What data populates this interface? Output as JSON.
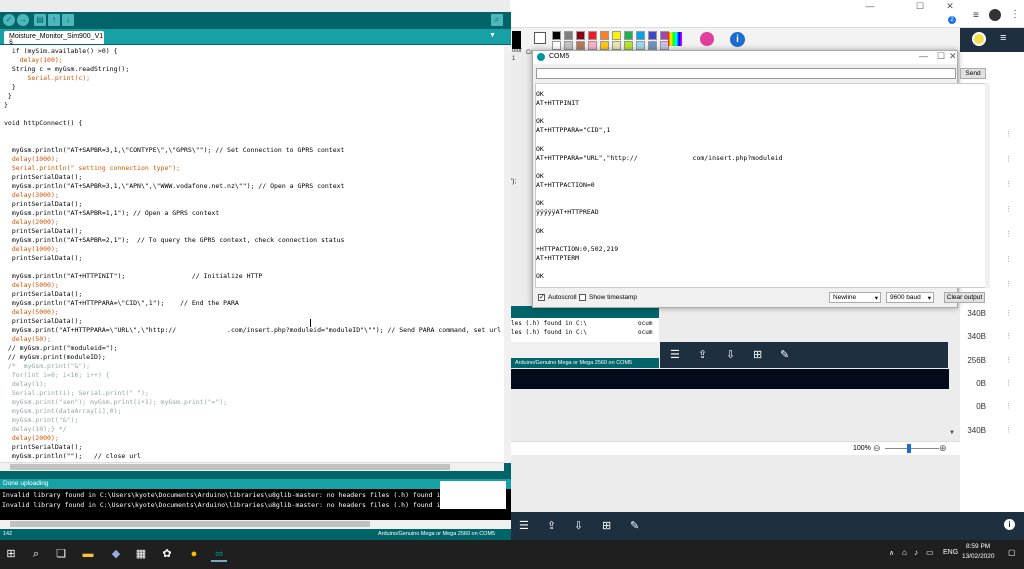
{
  "ide": {
    "tab_label": "Moisture_Monitor_Sim900_V1 §",
    "code_lines": [
      {
        "t": "  if (mySim.available() >0) {",
        "c": ""
      },
      {
        "t": "    delay(100);",
        "c": "kw"
      },
      {
        "t": "  String c = myGsm.readString();",
        "c": ""
      },
      {
        "t": "      Serial.print(c);",
        "c": "kw"
      },
      {
        "t": "  }",
        "c": ""
      },
      {
        "t": " }",
        "c": ""
      },
      {
        "t": "}",
        "c": ""
      },
      {
        "t": "",
        "c": ""
      },
      {
        "t": "void httpConnect() {",
        "c": ""
      },
      {
        "t": "",
        "c": ""
      },
      {
        "t": "",
        "c": ""
      },
      {
        "t": "  myGsm.println(\"AT+SAPBR=3,1,\\\"CONTYPE\\\",\\\"GPRS\\\"\"); // Set Connection to GPRS context",
        "c": ""
      },
      {
        "t": "  delay(1000);",
        "c": "kw"
      },
      {
        "t": "  Serial.println(\" setting connection type\");",
        "c": "kw"
      },
      {
        "t": "  printSerialData();",
        "c": ""
      },
      {
        "t": "  myGsm.println(\"AT+SAPBR=3,1,\\\"APN\\\",\\\"WWW.vodafone.net.nz\\\"\"); // Open a GPRS context",
        "c": ""
      },
      {
        "t": "  delay(3000);",
        "c": "kw"
      },
      {
        "t": "  printSerialData();",
        "c": ""
      },
      {
        "t": "  myGsm.println(\"AT+SAPBR=1,1\"); // Open a GPRS context",
        "c": ""
      },
      {
        "t": "  delay(2000);",
        "c": "kw"
      },
      {
        "t": "  printSerialData();",
        "c": ""
      },
      {
        "t": "  myGsm.println(\"AT+SAPBR=2,1\");  // To query the GPRS context, check connection status",
        "c": ""
      },
      {
        "t": "  delay(1000);",
        "c": "kw"
      },
      {
        "t": "  printSerialData();",
        "c": ""
      },
      {
        "t": "",
        "c": ""
      },
      {
        "t": "  myGsm.println(\"AT+HTTPINIT\");                 // Initialize HTTP",
        "c": ""
      },
      {
        "t": "  delay(5000);",
        "c": "kw"
      },
      {
        "t": "  printSerialData();",
        "c": ""
      },
      {
        "t": "  myGsm.println(\"AT+HTTPPARA=\\\"CID\\\",1\");    // End the PARA",
        "c": ""
      },
      {
        "t": "  delay(5000);",
        "c": "kw"
      },
      {
        "t": "  printSerialData();",
        "c": ""
      },
      {
        "t": "  myGsm.print(\"AT+HTTPPARA=\\\"URL\\\",\\\"http://             .com/insert.php?moduleid=\"moduleID\"\\\"\"); // Send PARA command, set url to",
        "c": ""
      },
      {
        "t": "  delay(50);",
        "c": "kw"
      },
      {
        "t": " // myGsm.print(\"moduleid=\");",
        "c": ""
      },
      {
        "t": " // myGsm.print(moduleID);",
        "c": ""
      },
      {
        "t": " /*  myGsm.print(\"&\");",
        "c": "cm"
      },
      {
        "t": "  for(int i=0; i<16; i++) {",
        "c": "cm"
      },
      {
        "t": "  delay(1);",
        "c": "cm"
      },
      {
        "t": "  Serial.print(i); Serial.print(\" \");",
        "c": "cm"
      },
      {
        "t": "  myGsm.print(\"sen\"); myGsm.print(i+1); myGsm.print(\"=\");",
        "c": "cm"
      },
      {
        "t": "  myGsm.print(dataArray[i],0);",
        "c": "cm"
      },
      {
        "t": "  myGsm.print(\"&\");",
        "c": "cm"
      },
      {
        "t": "  delay(10);} */",
        "c": "cm"
      },
      {
        "t": "  delay(2000);",
        "c": "kw"
      },
      {
        "t": "  printSerialData();",
        "c": ""
      },
      {
        "t": "  myGsm.println(\"\");   // close url",
        "c": ""
      },
      {
        "t": "  delay(5000);",
        "c": "kw"
      }
    ],
    "overflow_snippet": "\");",
    "status": "Done uploading",
    "console_lines": [
      "Invalid library found in C:\\Users\\kyote\\Documents\\Arduino\\libraries\\u8glib-master: no headers files (.h) found in C:\\",
      "Invalid library found in C:\\Users\\kyote\\Documents\\Arduino\\libraries\\u8glib-master: no headers files (.h) found in C:\\"
    ],
    "line_number": "142",
    "board": "Arduino/Genuino Mega or Mega 2560 on COM5"
  },
  "serial": {
    "title": "COM5",
    "send_label": "Send",
    "lines": [
      "OK",
      "AT+HTTPINIT",
      "",
      "OK",
      "AT+HTTPPARA=\"CID\",1",
      "",
      "OK",
      "AT+HTTPPARA=\"URL\",\"http://              com/insert.php?moduleid",
      "",
      "OK",
      "AT+HTTPACTION=0",
      "",
      "OK",
      "ÿÿÿÿÿAT+HTTPREAD",
      "",
      "OK",
      "",
      "+HTTPACTION:0,502,219",
      "AT+HTTPTERM",
      "",
      "OK"
    ],
    "autoscroll_label": "Autoscroll",
    "timestamp_label": "Show timestamp",
    "line_ending": "Newline",
    "baud": "9600 baud",
    "clear_label": "Clear output"
  },
  "ide2": {
    "console_lines": [
      "les (.h) found in C:\\",
      "les (.h) found in C:\\"
    ],
    "board": "Arduino/Genuino Mega or Mega 2560 on COM5",
    "right_fragment": "ocum"
  },
  "paint": {
    "colors": [
      "#000000",
      "#7f7f7f",
      "#880015",
      "#ed1c24",
      "#ff7f27",
      "#fff200",
      "#22b14c",
      "#00a2e8",
      "#3f48cc",
      "#a349a4"
    ],
    "colors2": [
      "#ffffff",
      "#c3c3c3",
      "#b97a57",
      "#ffaec9",
      "#ffc90e",
      "#efe4b0",
      "#b5e61d",
      "#99d9ea",
      "#7092be",
      "#c8bfe7"
    ]
  },
  "right_panel": {
    "sizes": [
      "340B",
      "340B",
      "256B",
      "0B",
      "0B",
      "340B"
    ]
  },
  "zoom": {
    "level": "100%"
  },
  "tray": {
    "lang": "ENG",
    "time": "8:59 PM",
    "date": "13/02/2020"
  },
  "chrome_badge": "2",
  "frag": {
    "color_label": "olor",
    "c_label": "Ci",
    "one": "1"
  }
}
